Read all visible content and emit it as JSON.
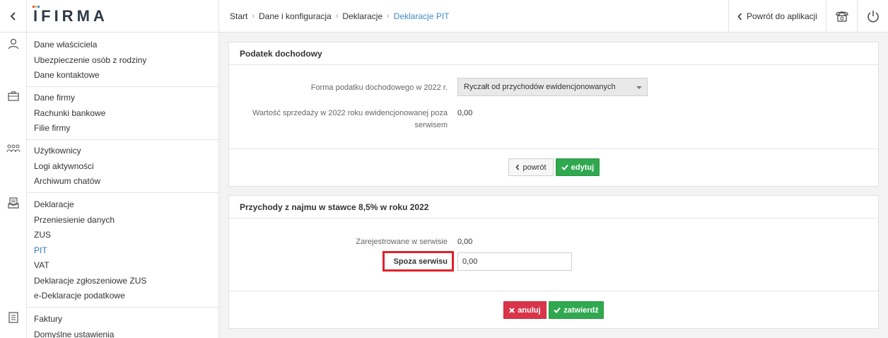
{
  "brand": {
    "logo_text": "IFIRMA",
    "bar_colors": [
      "#e84c3d",
      "#f3a33a",
      "#3d8ec9"
    ]
  },
  "nav": {
    "back_icon": "chevron-left-icon"
  },
  "sidebar": {
    "groups": [
      {
        "icon": "user-icon",
        "items": [
          "Dane właściciela",
          "Ubezpieczenie osób z rodziny",
          "Dane kontaktowe"
        ]
      },
      {
        "icon": "briefcase-icon",
        "items": [
          "Dane firmy",
          "Rachunki bankowe",
          "Filie firmy"
        ]
      },
      {
        "icon": "users-icon",
        "items": [
          "Użytkownicy",
          "Logi aktywności",
          "Archiwum chatów"
        ]
      },
      {
        "icon": "declarations-icon",
        "items": [
          "Deklaracje",
          "Przeniesienie danych",
          "ZUS",
          "PIT",
          "VAT",
          "Deklaracje zgłoszeniowe ZUS",
          "e-Deklaracje podatkowe"
        ]
      },
      {
        "icon": "invoice-icon",
        "items": [
          "Faktury",
          "Domyślne ustawienia"
        ]
      }
    ],
    "active_item": "PIT"
  },
  "breadcrumb": [
    "Start",
    "Dane i konfiguracja",
    "Deklaracje",
    "Deklaracje PIT"
  ],
  "topbar": {
    "back_label": "Powrót do aplikacji",
    "phone_icon": "phone-icon",
    "power_icon": "power-icon"
  },
  "panel1": {
    "title": "Podatek dochodowy",
    "form_label": "Forma podatku dochodowego w 2022 r.",
    "form_value": "Ryczałt od przychodów ewidencjonowanych",
    "sales_label_1": "Wartość sprzedaży w 2022 roku ewidencjonowanej poza",
    "sales_label_2": "serwisem",
    "sales_value": "0,00",
    "back_button": "powrót",
    "edit_button": "edytuj"
  },
  "panel2": {
    "title": "Przychody z najmu w stawce 8,5% w roku 2022",
    "registered_label": "Zarejestrowane w serwisie",
    "registered_value": "0,00",
    "outside_label": "Spoza serwisu",
    "outside_value": "0,00",
    "cancel_button": "anuluj",
    "confirm_button": "zatwierdź"
  },
  "colors": {
    "accent": "#3d8ec9",
    "success": "#2fa84f",
    "danger": "#d9354a",
    "highlight": "#e0202c"
  }
}
